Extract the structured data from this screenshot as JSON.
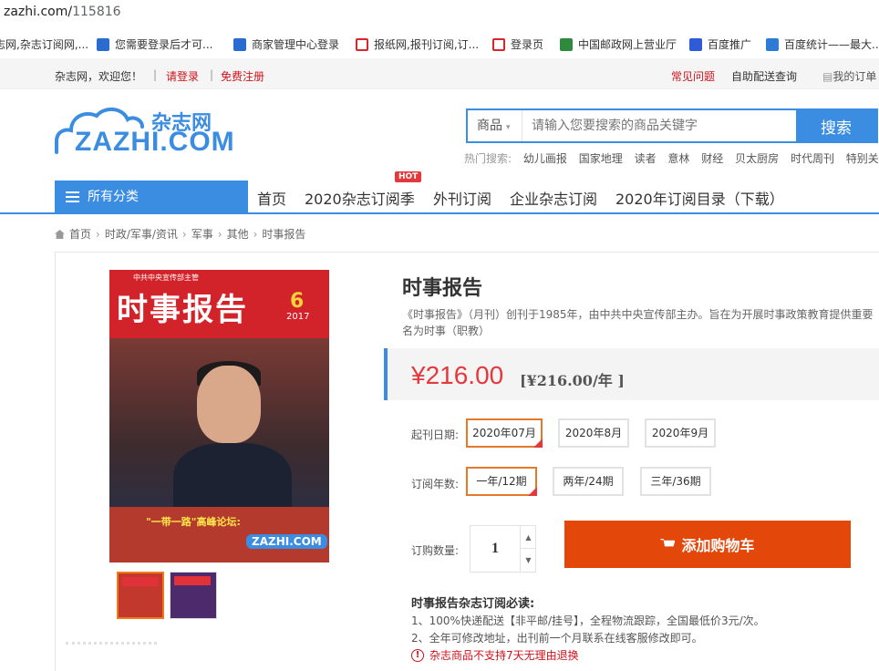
{
  "browser": {
    "url_host": "zazhi.com/",
    "url_path": "115816"
  },
  "bookmarks": [
    {
      "label": "志网,杂志订阅网,...",
      "icon": "edge-icon"
    },
    {
      "label": "您需要登录后才可...",
      "icon": "edge-icon"
    },
    {
      "label": "商家管理中心登录",
      "icon": "edge-icon"
    },
    {
      "label": "报纸网,报刊订阅,订...",
      "icon": "z-icon"
    },
    {
      "label": "登录页",
      "icon": "z-icon"
    },
    {
      "label": "中国邮政网上营业厅",
      "icon": "leaf-icon"
    },
    {
      "label": "百度推广",
      "icon": "paw-icon"
    },
    {
      "label": "百度统计——最大...",
      "icon": "chart-icon"
    }
  ],
  "topnav": {
    "greeting": "杂志网，欢迎您！",
    "login": "请登录",
    "register": "免费注册",
    "faq": "常见问题",
    "delivery": "自助配送查询",
    "orders": "我的订单"
  },
  "header": {
    "logo_cn": "杂志网",
    "logo_en": "ZAZHI.COM",
    "search_category": "商品",
    "search_placeholder": "请输入您要搜索的商品关键字",
    "search_button": "搜索",
    "hot_label": "热门搜索:",
    "hot_keywords": [
      "幼儿画报",
      "国家地理",
      "读者",
      "意林",
      "财经",
      "贝太厨房",
      "时代周刊",
      "特别关注"
    ]
  },
  "mainnav": {
    "all_categories": "所有分类",
    "items": [
      "首页",
      "2020杂志订阅季",
      "外刊订阅",
      "企业杂志订阅",
      "2020年订阅目录（下载）"
    ],
    "hot_badge": "HOT"
  },
  "breadcrumb": [
    "首页",
    "时政/军事/资讯",
    "军事",
    "其他",
    "时事报告"
  ],
  "product": {
    "cover": {
      "title": "时事报告",
      "issue": "6",
      "year": "2017",
      "headline": "\"一带一路\"高峰论坛:",
      "publisher_tag": "中共中央宣传部主管"
    },
    "title": "时事报告",
    "desc_line1": "《时事报告》（月刊）创刊于1985年，由中共中央宣传部主办。旨在为开展时事政策教育提供重要",
    "desc_line2": "名为时事（职教）",
    "price": "¥216.00",
    "price_per_year": "[¥216.00/年 ]",
    "start_label": "起刊日期:",
    "start_options": [
      "2020年07月",
      "2020年8月",
      "2020年9月"
    ],
    "start_selected": 0,
    "years_label": "订阅年数:",
    "year_options": [
      "一年/12期",
      "两年/24期",
      "三年/36期"
    ],
    "year_selected": 0,
    "qty_label": "订购数量:",
    "qty_value": "1",
    "cart_button": "添加购物车",
    "notice_title": "时事报告杂志订阅必读:",
    "notice_1": "1、100%快递配送【非平邮/挂号】，全程物流跟踪，全国最低价3元/次。",
    "notice_2": "2、全年可修改地址，出刊前一个月联系在线客服修改即可。",
    "warning": "杂志商品不支持7天无理由退换"
  },
  "colors": {
    "accent": "#3b8de2",
    "price": "#e4393c",
    "cart": "#e4470a",
    "selected": "#e6782a"
  }
}
